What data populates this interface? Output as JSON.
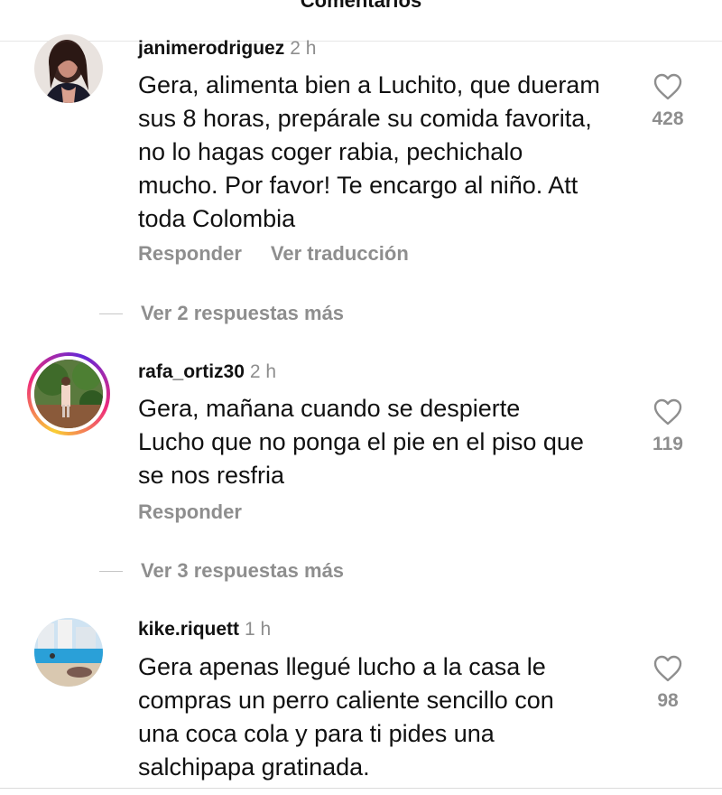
{
  "header": {
    "title": "Comentarios"
  },
  "comments": [
    {
      "username": "janimerodriguez",
      "time": "2 h",
      "text": "Gera, alimenta bien a Luchito, que dueram sus 8 horas, prepárale su comida favorita, no lo hagas coger rabia, pechichalo mucho. Por favor! Te encargo al niño. Att toda Colombia",
      "reply_label": "Responder",
      "translate_label": "Ver traducción",
      "likes": "428",
      "more_replies": "Ver 2 respuestas más"
    },
    {
      "username": "rafa_ortiz30",
      "time": "2 h",
      "text": "Gera, mañana cuando se despierte Lucho que no ponga el pie en el piso que se nos resfria",
      "reply_label": "Responder",
      "likes": "119",
      "more_replies": "Ver 3 respuestas más"
    },
    {
      "username": "kike.riquett",
      "time": "1 h",
      "text": "Gera apenas llegué lucho a la casa le compras un perro caliente sencillo con una coca cola y para ti pides una salchipapa gratinada.",
      "likes": "98"
    }
  ],
  "icons": {
    "like": "heart-outline-icon"
  }
}
